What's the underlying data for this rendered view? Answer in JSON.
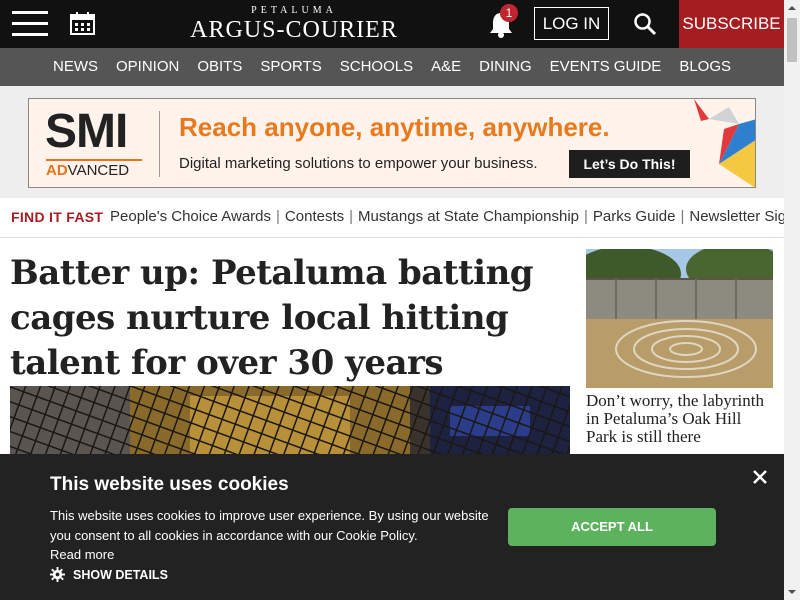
{
  "header": {
    "logo_small": "PETALUMA",
    "logo_big": "ARGUS-COURIER",
    "notification_count": "1",
    "login_label": "LOG IN",
    "subscribe_label": "SUBSCRIBE"
  },
  "nav": {
    "items": [
      "NEWS",
      "OPINION",
      "OBITS",
      "SPORTS",
      "SCHOOLS",
      "A&E",
      "DINING",
      "EVENTS GUIDE",
      "BLOGS"
    ]
  },
  "ad": {
    "brand_top": "SMI",
    "brand_ad": "AD",
    "brand_rest": "VANCED",
    "headline": "Reach anyone, anytime, anywhere.",
    "subline": "Digital marketing solutions to empower your business.",
    "cta": "Let’s Do This!"
  },
  "find_fast": {
    "label": "FIND IT FAST",
    "links": [
      "People's Choice Awards",
      "Contests",
      "Mustangs at State Championship",
      "Parks Guide",
      "Newsletter Sign"
    ]
  },
  "article": {
    "headline": "Batter up: Petaluma batting cages nurture local hitting talent for over 30 years"
  },
  "sidebar": {
    "caption": "Don’t worry, the labyrinth in Petaluma’s Oak Hill Park is still there"
  },
  "cookie_banner": {
    "title": "This website uses cookies",
    "body": "This website uses cookies to improve user experience. By using our website you consent to all cookies in accordance with our Cookie Policy.",
    "read_more": "Read more",
    "details_label": "SHOW DETAILS",
    "accept_label": "ACCEPT ALL"
  },
  "colors": {
    "brand_red": "#a51d21",
    "nav_gray": "#555555",
    "accept_green": "#5db25d",
    "ad_orange": "#e87a1d"
  }
}
